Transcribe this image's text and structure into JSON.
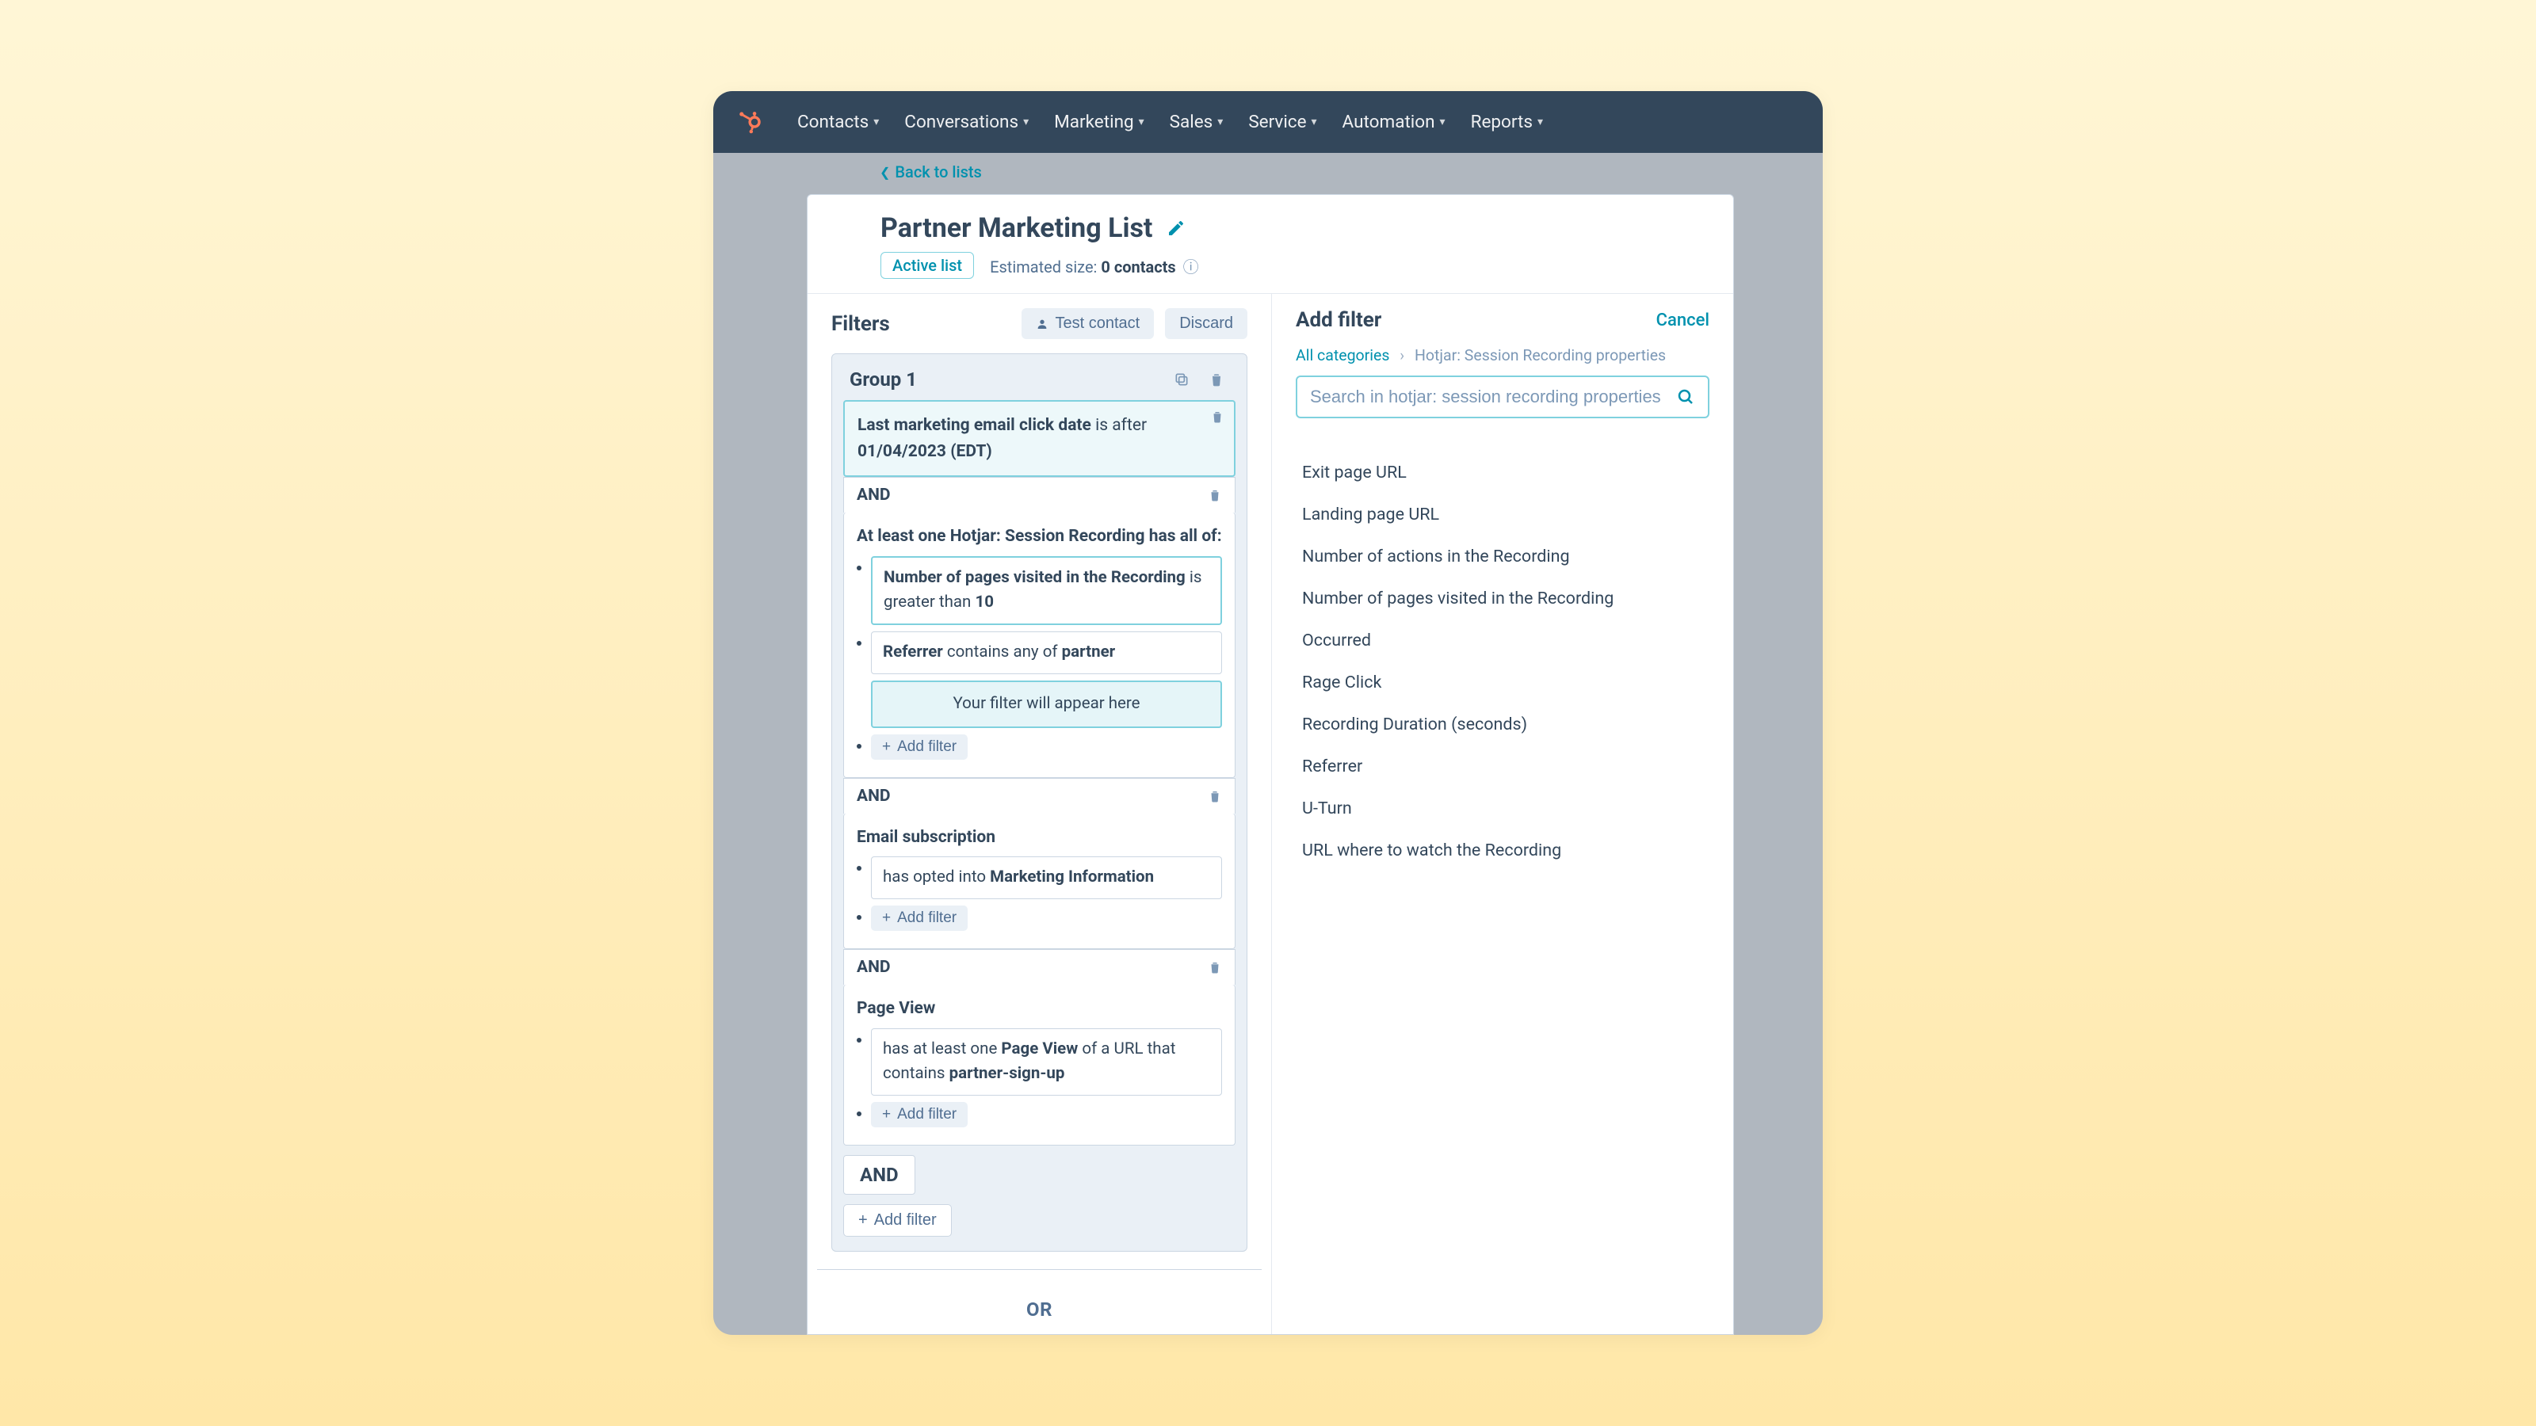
{
  "nav": {
    "items": [
      "Contacts",
      "Conversations",
      "Marketing",
      "Sales",
      "Service",
      "Automation",
      "Reports"
    ]
  },
  "back_link": "Back to lists",
  "page": {
    "title": "Partner Marketing List",
    "active_chip": "Active list",
    "estimated_label": "Estimated size:",
    "estimated_value": "0 contacts"
  },
  "left": {
    "title": "Filters",
    "test_contact": "Test contact",
    "discard": "Discard",
    "group_title": "Group 1",
    "and_label": "AND",
    "or_label": "OR",
    "add_filter": "Add filter",
    "c1": {
      "prop": "Last marketing email click date",
      "op": "is after",
      "val": "01/04/2023 (EDT)"
    },
    "c2": {
      "head_pre": "At least one",
      "head_obj": "Hotjar: Session Recording",
      "head_post": "has all of:",
      "a": {
        "prop": "Number of pages visited in the Recording",
        "op": "is greater than",
        "val": "10"
      },
      "b": {
        "prop": "Referrer",
        "op": "contains any of",
        "val": "partner"
      },
      "placeholder": "Your filter will appear here"
    },
    "c3": {
      "head": "Email subscription",
      "pre": "has opted into",
      "val": "Marketing Information"
    },
    "c4": {
      "head": "Page View",
      "pre": "has at least one",
      "obj": "Page View",
      "mid": "of a URL that contains",
      "val": "partner-sign-up"
    }
  },
  "right": {
    "title": "Add filter",
    "cancel": "Cancel",
    "crumb_root": "All categories",
    "crumb_cur": "Hotjar: Session Recording properties",
    "search_ph": "Search in hotjar: session recording properties",
    "props": [
      "Exit page URL",
      "Landing page URL",
      "Number of actions in the Recording",
      "Number of pages visited in the Recording",
      "Occurred",
      "Rage Click",
      "Recording Duration (seconds)",
      "Referrer",
      "U-Turn",
      "URL where to watch the Recording"
    ]
  }
}
